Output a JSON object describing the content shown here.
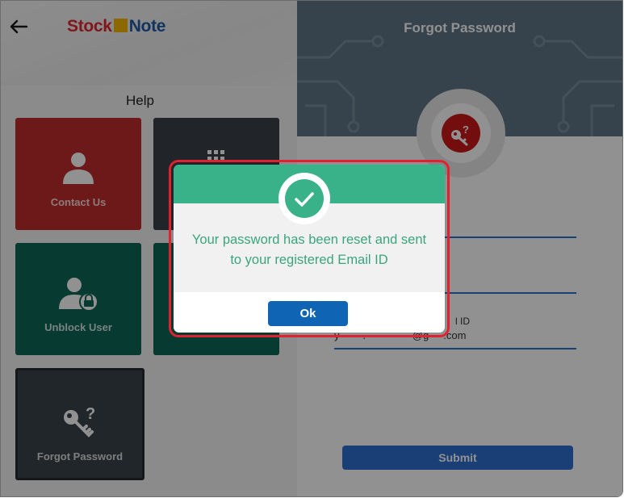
{
  "app": {
    "logo": {
      "part1": "Stock",
      "part2": "Note"
    }
  },
  "help": {
    "title": "Help",
    "tiles": [
      {
        "label": "Contact Us",
        "icon": "user-icon"
      },
      {
        "label": "",
        "icon": "grid-icon"
      },
      {
        "label": "Unblock User",
        "icon": "user-lock-icon"
      },
      {
        "label": "",
        "icon": ""
      },
      {
        "label": "Forgot Password",
        "icon": "key-question-icon"
      }
    ]
  },
  "forgot_form": {
    "title": "Forgot Password",
    "email_label_partial": "l ID",
    "email_value_partial": "y        .                @g     .com",
    "submit_label": "Submit"
  },
  "dialog": {
    "message_line1": "Your password has been reset and sent",
    "message_line2": "to your registered Email ID",
    "ok_label": "Ok",
    "icon": "checkmark-icon"
  },
  "colors": {
    "contact_tile": "#c22c2d",
    "unblock_tile": "#0e6859",
    "dialog_accent": "#3ab289",
    "ok_button": "#1064b4",
    "highlight_outline": "#e02130",
    "header_right": "#5f7788"
  }
}
